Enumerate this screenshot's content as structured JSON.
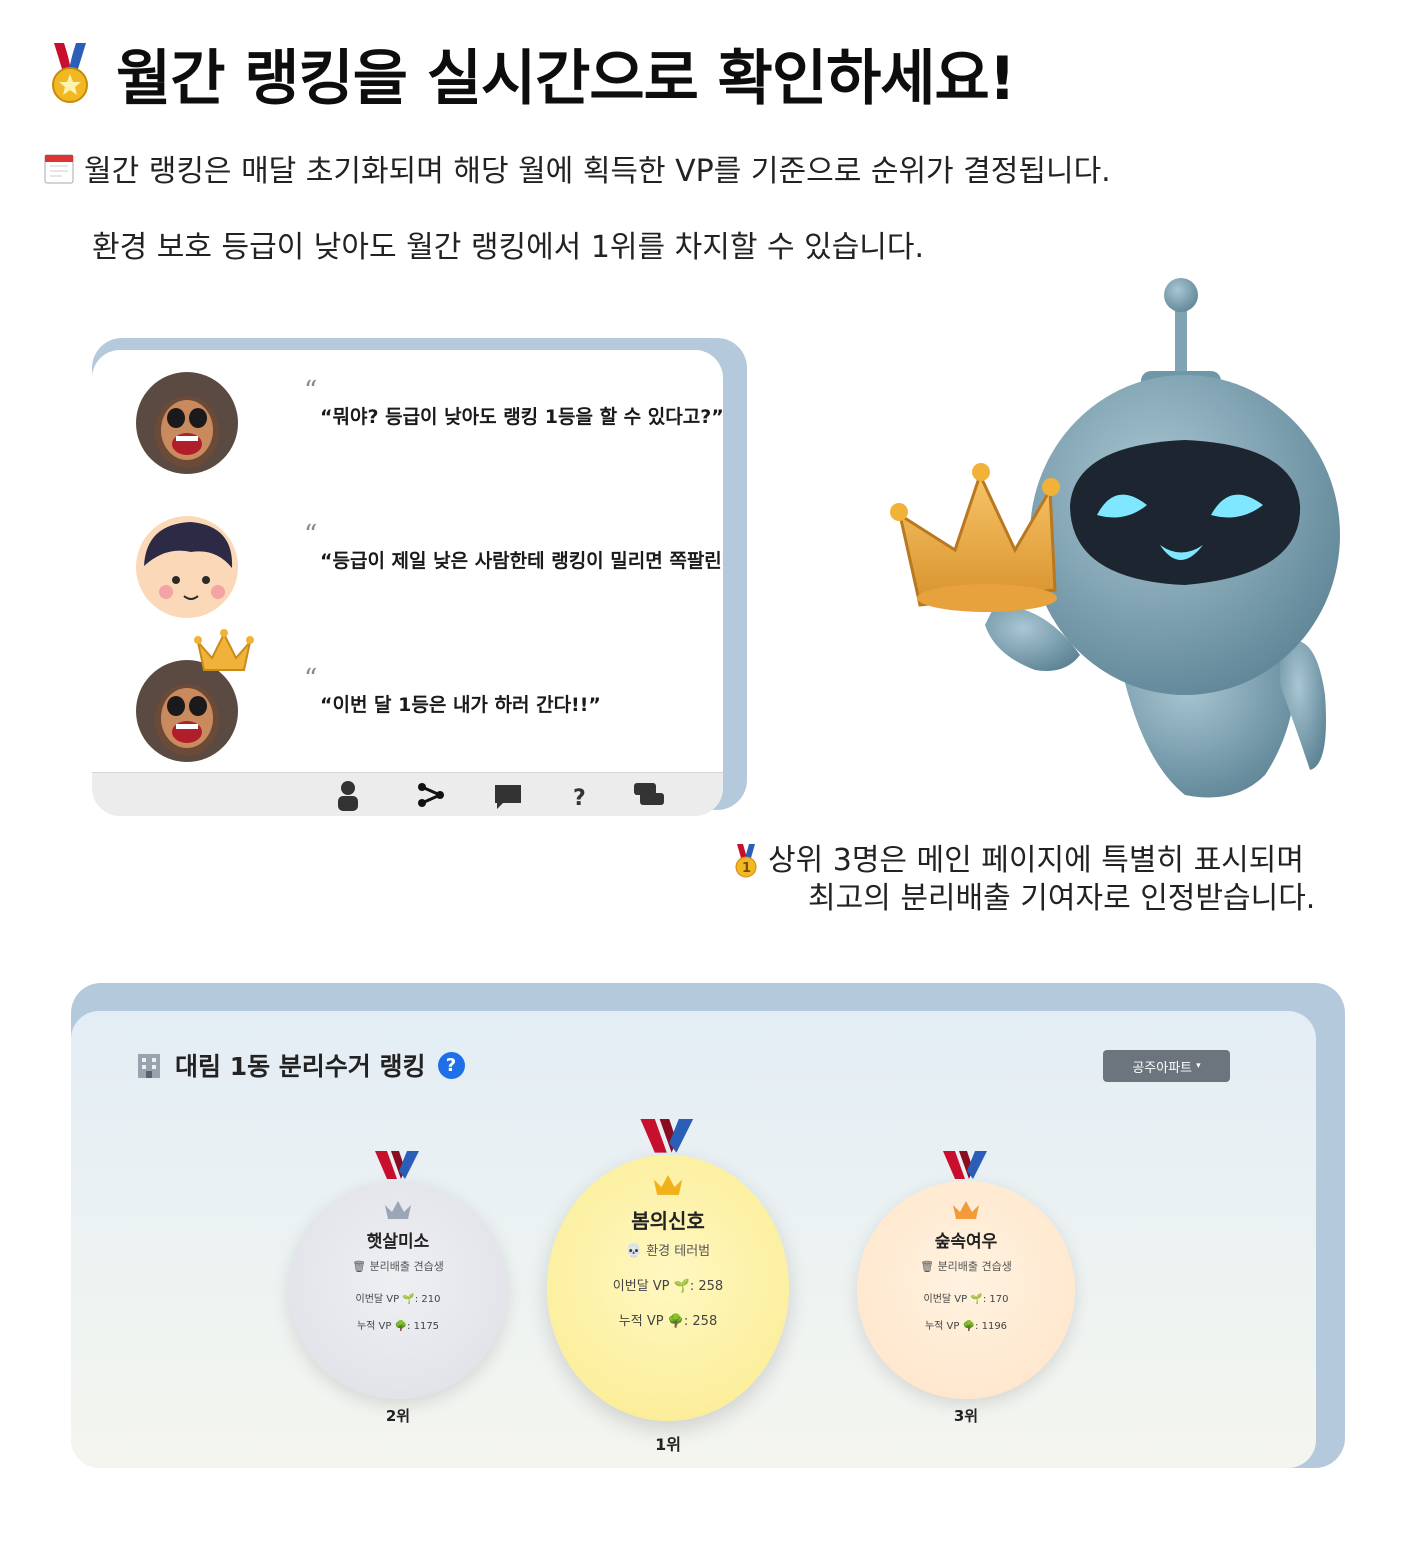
{
  "header": {
    "title": "월간 랭킹을 실시간으로 확인하세요!",
    "line1": "월간 랭킹은 매달 초기화되며 해당 월에 획득한 VP를 기준으로 순위가 결정됩니다.",
    "line2": "환경 보호 등급이 낮아도 월간 랭킹에서 1위를 차지할 수 있습니다."
  },
  "chat": {
    "messages": [
      {
        "text": "“뭐야? 등급이 낮아도 랭킹 1등을 할 수 있다고?”"
      },
      {
        "text": "“등급이 제일 낮은 사람한테 랭킹이 밀리면 쪽팔린데..”"
      },
      {
        "text": "“이번 달 1등은 내가 하러 간다!!”"
      }
    ],
    "quote_mark": "“",
    "bar_icons": [
      "person-icon",
      "share-icon",
      "chat-icon",
      "question-icon",
      "messages-icon"
    ]
  },
  "note": {
    "line1": "상위 3명은 메인 페이지에 특별히 표시되며",
    "line2": "최고의 분리배출 기여자로 인정받습니다."
  },
  "ranking": {
    "title": "대림 1동 분리수거 랭킹",
    "help": "?",
    "dropdown": "공주아파트",
    "podium": [
      {
        "rank": "2위",
        "name": "햇살미소",
        "title": "분리배출 견습생",
        "month_label": "이번달 VP",
        "month_vp": "210",
        "total_label": "누적 VP",
        "total_vp": "1175",
        "color": "#e4e5eb"
      },
      {
        "rank": "1위",
        "name": "봄의신호",
        "title": "환경 테러범",
        "month_label": "이번달 VP",
        "month_vp": "258",
        "total_label": "누적 VP",
        "total_vp": "258",
        "color": "#fcef9e"
      },
      {
        "rank": "3위",
        "name": "숲속여우",
        "title": "분리배출 견습생",
        "month_label": "이번달 VP",
        "month_vp": "170",
        "total_label": "누적 VP",
        "total_vp": "1196",
        "color": "#ffe8cf"
      }
    ]
  },
  "colors": {
    "panel_back": "#b5c9dd",
    "help_blue": "#1f6fe8",
    "ribbon_red": "#c8102e",
    "ribbon_blue": "#2b5fb7",
    "robot_body": "#7fa3b3",
    "glow_cyan": "#7fe7ff"
  }
}
